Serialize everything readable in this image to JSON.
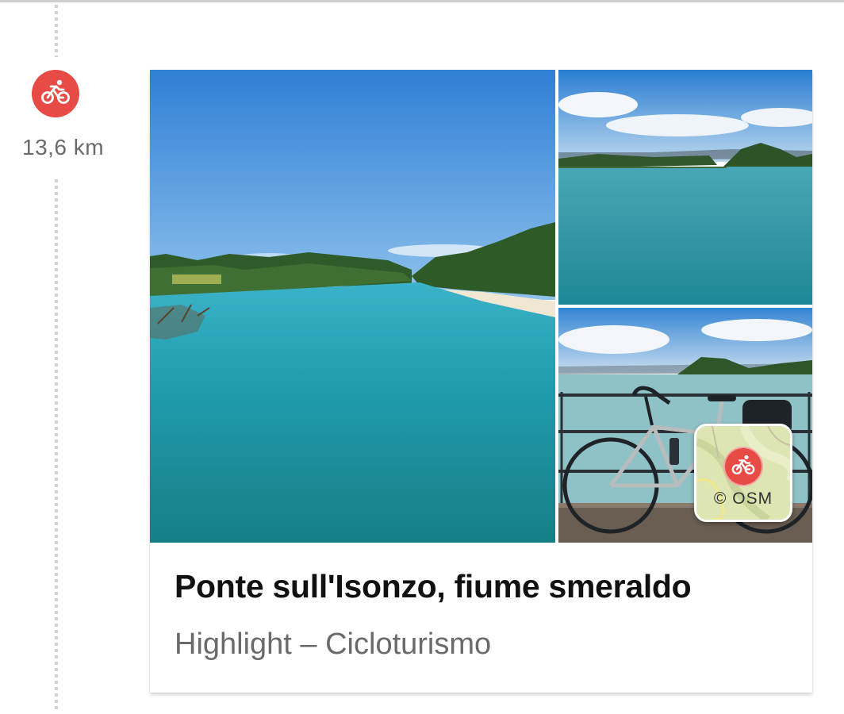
{
  "timeline": {
    "sport_icon": "bicycle-icon",
    "distance": "13,6 km"
  },
  "highlight_card": {
    "title": "Ponte sull'Isonzo, fiume smeraldo",
    "subtitle": "Highlight – Cicloturismo",
    "photos": [
      "river-bend-photo",
      "river-island-photo",
      "bicycle-on-bridge-photo"
    ],
    "map_thumbnail": {
      "icon": "bicycle-icon",
      "attribution": "© OSM"
    }
  },
  "colors": {
    "accent": "#e84b46",
    "water": "#1f9aa8",
    "sky": "#2f86d8",
    "title_text": "#111111",
    "muted_text": "#6a6a6a"
  }
}
